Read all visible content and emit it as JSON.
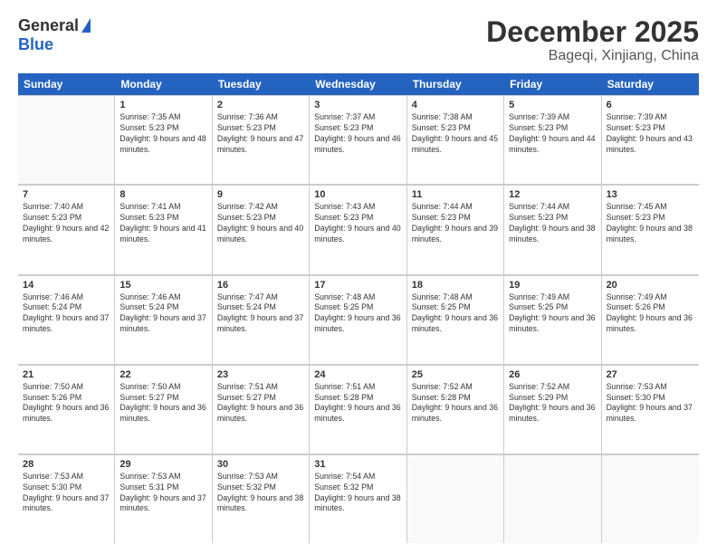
{
  "logo": {
    "general": "General",
    "blue": "Blue"
  },
  "title": "December 2025",
  "subtitle": "Bageqi, Xinjiang, China",
  "days_of_week": [
    "Sunday",
    "Monday",
    "Tuesday",
    "Wednesday",
    "Thursday",
    "Friday",
    "Saturday"
  ],
  "weeks": [
    [
      {
        "day": "",
        "sunrise": "",
        "sunset": "",
        "daylight": ""
      },
      {
        "day": "1",
        "sunrise": "Sunrise: 7:35 AM",
        "sunset": "Sunset: 5:23 PM",
        "daylight": "Daylight: 9 hours and 48 minutes."
      },
      {
        "day": "2",
        "sunrise": "Sunrise: 7:36 AM",
        "sunset": "Sunset: 5:23 PM",
        "daylight": "Daylight: 9 hours and 47 minutes."
      },
      {
        "day": "3",
        "sunrise": "Sunrise: 7:37 AM",
        "sunset": "Sunset: 5:23 PM",
        "daylight": "Daylight: 9 hours and 46 minutes."
      },
      {
        "day": "4",
        "sunrise": "Sunrise: 7:38 AM",
        "sunset": "Sunset: 5:23 PM",
        "daylight": "Daylight: 9 hours and 45 minutes."
      },
      {
        "day": "5",
        "sunrise": "Sunrise: 7:39 AM",
        "sunset": "Sunset: 5:23 PM",
        "daylight": "Daylight: 9 hours and 44 minutes."
      },
      {
        "day": "6",
        "sunrise": "Sunrise: 7:39 AM",
        "sunset": "Sunset: 5:23 PM",
        "daylight": "Daylight: 9 hours and 43 minutes."
      }
    ],
    [
      {
        "day": "7",
        "sunrise": "Sunrise: 7:40 AM",
        "sunset": "Sunset: 5:23 PM",
        "daylight": "Daylight: 9 hours and 42 minutes."
      },
      {
        "day": "8",
        "sunrise": "Sunrise: 7:41 AM",
        "sunset": "Sunset: 5:23 PM",
        "daylight": "Daylight: 9 hours and 41 minutes."
      },
      {
        "day": "9",
        "sunrise": "Sunrise: 7:42 AM",
        "sunset": "Sunset: 5:23 PM",
        "daylight": "Daylight: 9 hours and 40 minutes."
      },
      {
        "day": "10",
        "sunrise": "Sunrise: 7:43 AM",
        "sunset": "Sunset: 5:23 PM",
        "daylight": "Daylight: 9 hours and 40 minutes."
      },
      {
        "day": "11",
        "sunrise": "Sunrise: 7:44 AM",
        "sunset": "Sunset: 5:23 PM",
        "daylight": "Daylight: 9 hours and 39 minutes."
      },
      {
        "day": "12",
        "sunrise": "Sunrise: 7:44 AM",
        "sunset": "Sunset: 5:23 PM",
        "daylight": "Daylight: 9 hours and 38 minutes."
      },
      {
        "day": "13",
        "sunrise": "Sunrise: 7:45 AM",
        "sunset": "Sunset: 5:23 PM",
        "daylight": "Daylight: 9 hours and 38 minutes."
      }
    ],
    [
      {
        "day": "14",
        "sunrise": "Sunrise: 7:46 AM",
        "sunset": "Sunset: 5:24 PM",
        "daylight": "Daylight: 9 hours and 37 minutes."
      },
      {
        "day": "15",
        "sunrise": "Sunrise: 7:46 AM",
        "sunset": "Sunset: 5:24 PM",
        "daylight": "Daylight: 9 hours and 37 minutes."
      },
      {
        "day": "16",
        "sunrise": "Sunrise: 7:47 AM",
        "sunset": "Sunset: 5:24 PM",
        "daylight": "Daylight: 9 hours and 37 minutes."
      },
      {
        "day": "17",
        "sunrise": "Sunrise: 7:48 AM",
        "sunset": "Sunset: 5:25 PM",
        "daylight": "Daylight: 9 hours and 36 minutes."
      },
      {
        "day": "18",
        "sunrise": "Sunrise: 7:48 AM",
        "sunset": "Sunset: 5:25 PM",
        "daylight": "Daylight: 9 hours and 36 minutes."
      },
      {
        "day": "19",
        "sunrise": "Sunrise: 7:49 AM",
        "sunset": "Sunset: 5:25 PM",
        "daylight": "Daylight: 9 hours and 36 minutes."
      },
      {
        "day": "20",
        "sunrise": "Sunrise: 7:49 AM",
        "sunset": "Sunset: 5:26 PM",
        "daylight": "Daylight: 9 hours and 36 minutes."
      }
    ],
    [
      {
        "day": "21",
        "sunrise": "Sunrise: 7:50 AM",
        "sunset": "Sunset: 5:26 PM",
        "daylight": "Daylight: 9 hours and 36 minutes."
      },
      {
        "day": "22",
        "sunrise": "Sunrise: 7:50 AM",
        "sunset": "Sunset: 5:27 PM",
        "daylight": "Daylight: 9 hours and 36 minutes."
      },
      {
        "day": "23",
        "sunrise": "Sunrise: 7:51 AM",
        "sunset": "Sunset: 5:27 PM",
        "daylight": "Daylight: 9 hours and 36 minutes."
      },
      {
        "day": "24",
        "sunrise": "Sunrise: 7:51 AM",
        "sunset": "Sunset: 5:28 PM",
        "daylight": "Daylight: 9 hours and 36 minutes."
      },
      {
        "day": "25",
        "sunrise": "Sunrise: 7:52 AM",
        "sunset": "Sunset: 5:28 PM",
        "daylight": "Daylight: 9 hours and 36 minutes."
      },
      {
        "day": "26",
        "sunrise": "Sunrise: 7:52 AM",
        "sunset": "Sunset: 5:29 PM",
        "daylight": "Daylight: 9 hours and 36 minutes."
      },
      {
        "day": "27",
        "sunrise": "Sunrise: 7:53 AM",
        "sunset": "Sunset: 5:30 PM",
        "daylight": "Daylight: 9 hours and 37 minutes."
      }
    ],
    [
      {
        "day": "28",
        "sunrise": "Sunrise: 7:53 AM",
        "sunset": "Sunset: 5:30 PM",
        "daylight": "Daylight: 9 hours and 37 minutes."
      },
      {
        "day": "29",
        "sunrise": "Sunrise: 7:53 AM",
        "sunset": "Sunset: 5:31 PM",
        "daylight": "Daylight: 9 hours and 37 minutes."
      },
      {
        "day": "30",
        "sunrise": "Sunrise: 7:53 AM",
        "sunset": "Sunset: 5:32 PM",
        "daylight": "Daylight: 9 hours and 38 minutes."
      },
      {
        "day": "31",
        "sunrise": "Sunrise: 7:54 AM",
        "sunset": "Sunset: 5:32 PM",
        "daylight": "Daylight: 9 hours and 38 minutes."
      },
      {
        "day": "",
        "sunrise": "",
        "sunset": "",
        "daylight": ""
      },
      {
        "day": "",
        "sunrise": "",
        "sunset": "",
        "daylight": ""
      },
      {
        "day": "",
        "sunrise": "",
        "sunset": "",
        "daylight": ""
      }
    ]
  ]
}
